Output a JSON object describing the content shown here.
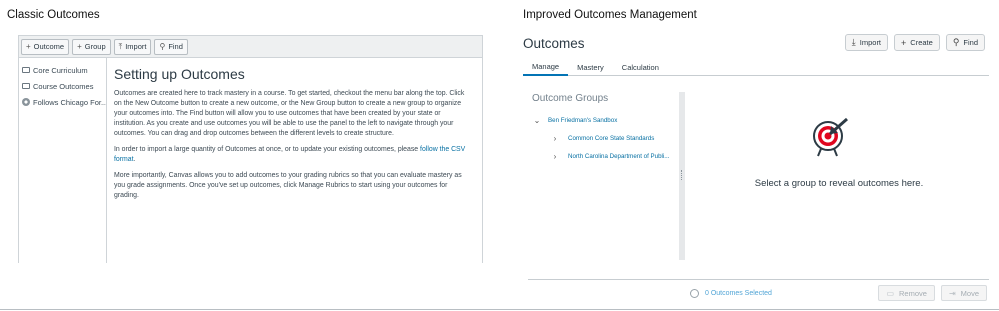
{
  "classic": {
    "panel_title": "Classic Outcomes",
    "toolbar": [
      {
        "icon": "plus-icon",
        "glyph": "+",
        "label": "Outcome"
      },
      {
        "icon": "plus-icon",
        "glyph": "+",
        "label": "Group"
      },
      {
        "icon": "import-icon",
        "glyph": "⤒",
        "label": "Import"
      },
      {
        "icon": "search-icon",
        "glyph": "⚲",
        "label": "Find"
      }
    ],
    "sidebar": [
      {
        "icon": "folder-icon",
        "label": "Core Curriculum"
      },
      {
        "icon": "folder-icon",
        "label": "Course Outcomes"
      },
      {
        "icon": "globe-icon",
        "label": "Follows Chicago For..."
      }
    ],
    "heading": "Setting up Outcomes",
    "para1": "Outcomes are created here to track mastery in a course. To get started, checkout the menu bar along the top. Click on the New Outcome button to create a new outcome, or the New Group button to create a new group to organize your outcomes into. The Find button will allow you to use outcomes that have been created by your state or institution. As you create and use outcomes you will be able to use the panel to the left to navigate through your outcomes. You can drag and drop outcomes between the different levels to create structure.",
    "para2_before": "In order to import a large quantity of Outcomes at once, or to update your existing outcomes, please ",
    "para2_link": "follow the CSV format",
    "para2_after": ".",
    "para3": "More importantly, Canvas allows you to add outcomes to your grading rubrics so that you can evaluate mastery as you grade assignments. Once you've set up outcomes, click Manage Rubrics to start using your outcomes for grading."
  },
  "improved": {
    "panel_title": "Improved Outcomes Management",
    "title": "Outcomes",
    "actions": [
      {
        "icon": "import-icon",
        "glyph": "⤓",
        "label": "Import"
      },
      {
        "icon": "plus-icon",
        "glyph": "+",
        "label": "Create"
      },
      {
        "icon": "search-icon",
        "glyph": "⚲",
        "label": "Find"
      }
    ],
    "tabs": [
      {
        "label": "Manage",
        "active": true
      },
      {
        "label": "Mastery",
        "active": false
      },
      {
        "label": "Calculation",
        "active": false
      }
    ],
    "groups_heading": "Outcome Groups",
    "root_group": "Ben Friedman's Sandbox",
    "groups": [
      "Common Core State Standards",
      "North Carolina Department of Publi..."
    ],
    "reveal_text": "Select a group to reveal outcomes here.",
    "selected_count": "0 Outcomes Selected",
    "footer_actions": [
      {
        "icon": "trash-icon",
        "glyph": "🗑",
        "label": "Remove"
      },
      {
        "icon": "move-icon",
        "glyph": "⇥",
        "label": "Move"
      }
    ],
    "colors": {
      "accent": "#0374b5",
      "link": "#0770a3",
      "target_red": "#e0061f"
    }
  }
}
